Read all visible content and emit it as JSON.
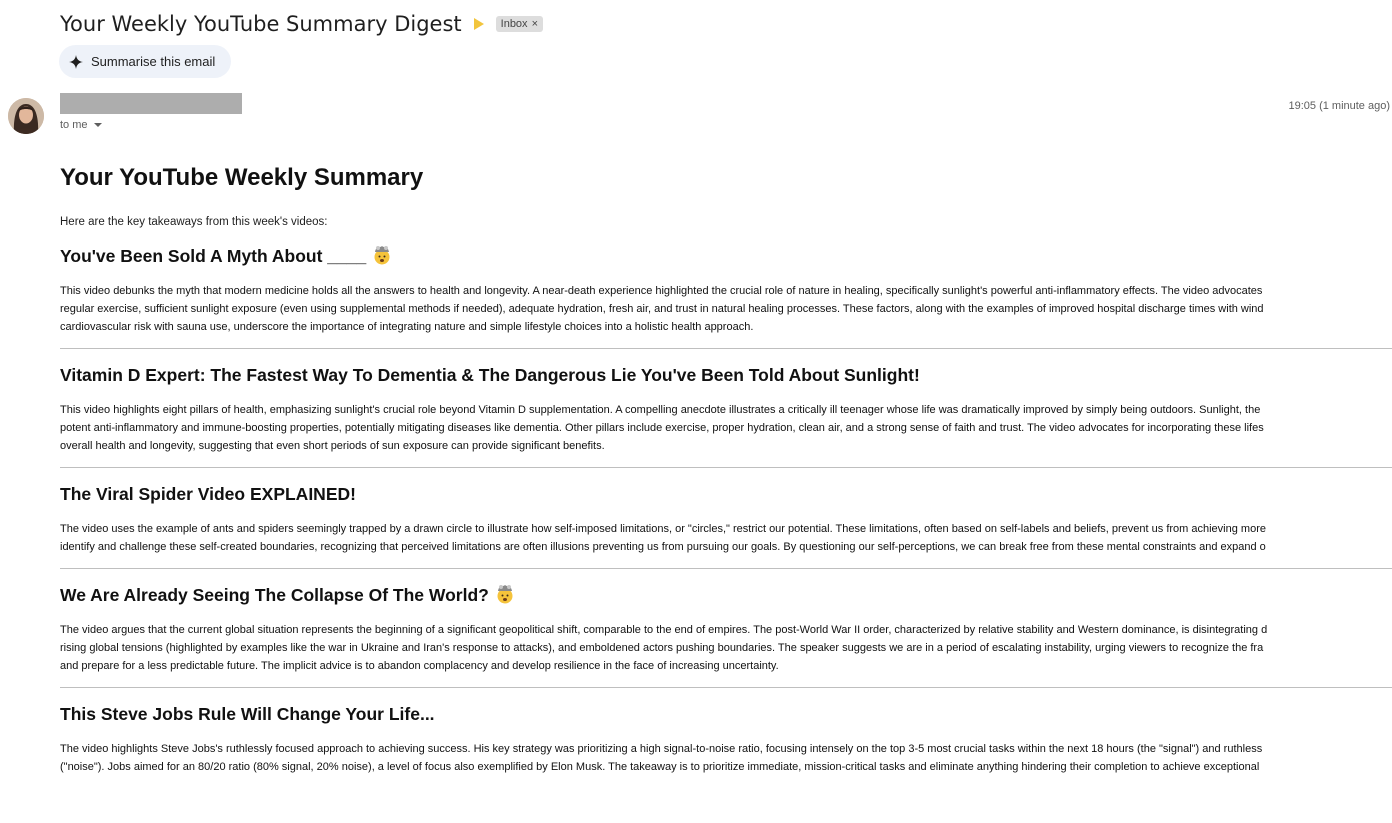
{
  "email": {
    "subject": "Your Weekly YouTube Summary Digest",
    "label": "Inbox",
    "label_remove": "×",
    "summarise_label": "Summarise this email",
    "recipient": "to me",
    "timestamp": "19:05 (1 minute ago)"
  },
  "content": {
    "title": "Your YouTube Weekly Summary",
    "intro": "Here are the key takeaways from this week's videos:",
    "videos": [
      {
        "title": "You've Been Sold A Myth About ____",
        "emoji": "exploding-head-icon",
        "lines": [
          "This video debunks the myth that modern medicine holds all the answers to health and longevity. A near-death experience highlighted the crucial role of nature in healing, specifically sunlight's powerful anti-inflammatory effects. The video advocates",
          "regular exercise, sufficient sunlight exposure (even using supplemental methods if needed), adequate hydration, fresh air, and trust in natural healing processes. These factors, along with the examples of improved hospital discharge times with wind",
          "cardiovascular risk with sauna use, underscore the importance of integrating nature and simple lifestyle choices into a holistic health approach."
        ]
      },
      {
        "title": "Vitamin D Expert: The Fastest Way To Dementia & The Dangerous Lie You've Been Told About Sunlight!",
        "emoji": "",
        "lines": [
          "This video highlights eight pillars of health, emphasizing sunlight's crucial role beyond Vitamin D supplementation. A compelling anecdote illustrates a critically ill teenager whose life was dramatically improved by simply being outdoors. Sunlight, the",
          "potent anti-inflammatory and immune-boosting properties, potentially mitigating diseases like dementia. Other pillars include exercise, proper hydration, clean air, and a strong sense of faith and trust. The video advocates for incorporating these lifes",
          "overall health and longevity, suggesting that even short periods of sun exposure can provide significant benefits."
        ]
      },
      {
        "title": "The Viral Spider Video EXPLAINED!",
        "emoji": "",
        "lines": [
          "The video uses the example of ants and spiders seemingly trapped by a drawn circle to illustrate how self-imposed limitations, or \"circles,\" restrict our potential. These limitations, often based on self-labels and beliefs, prevent us from achieving more",
          "identify and challenge these self-created boundaries, recognizing that perceived limitations are often illusions preventing us from pursuing our goals. By questioning our self-perceptions, we can break free from these mental constraints and expand o"
        ]
      },
      {
        "title": "We Are Already Seeing The Collapse Of The World?",
        "emoji": "exploding-head-icon",
        "lines": [
          "The video argues that the current global situation represents the beginning of a significant geopolitical shift, comparable to the end of empires. The post-World War II order, characterized by relative stability and Western dominance, is disintegrating d",
          "rising global tensions (highlighted by examples like the war in Ukraine and Iran's response to attacks), and emboldened actors pushing boundaries. The speaker suggests we are in a period of escalating instability, urging viewers to recognize the fra",
          "and prepare for a less predictable future. The implicit advice is to abandon complacency and develop resilience in the face of increasing uncertainty."
        ]
      },
      {
        "title": "This Steve Jobs Rule Will Change Your Life...",
        "emoji": "",
        "lines": [
          "The video highlights Steve Jobs's ruthlessly focused approach to achieving success. His key strategy was prioritizing a high signal-to-noise ratio, focusing intensely on the top 3-5 most crucial tasks within the next 18 hours (the \"signal\") and ruthless",
          "(\"noise\"). Jobs aimed for an 80/20 ratio (80% signal, 20% noise), a level of focus also exemplified by Elon Musk. The takeaway is to prioritize immediate, mission-critical tasks and eliminate anything hindering their completion to achieve exceptional"
        ]
      }
    ]
  }
}
